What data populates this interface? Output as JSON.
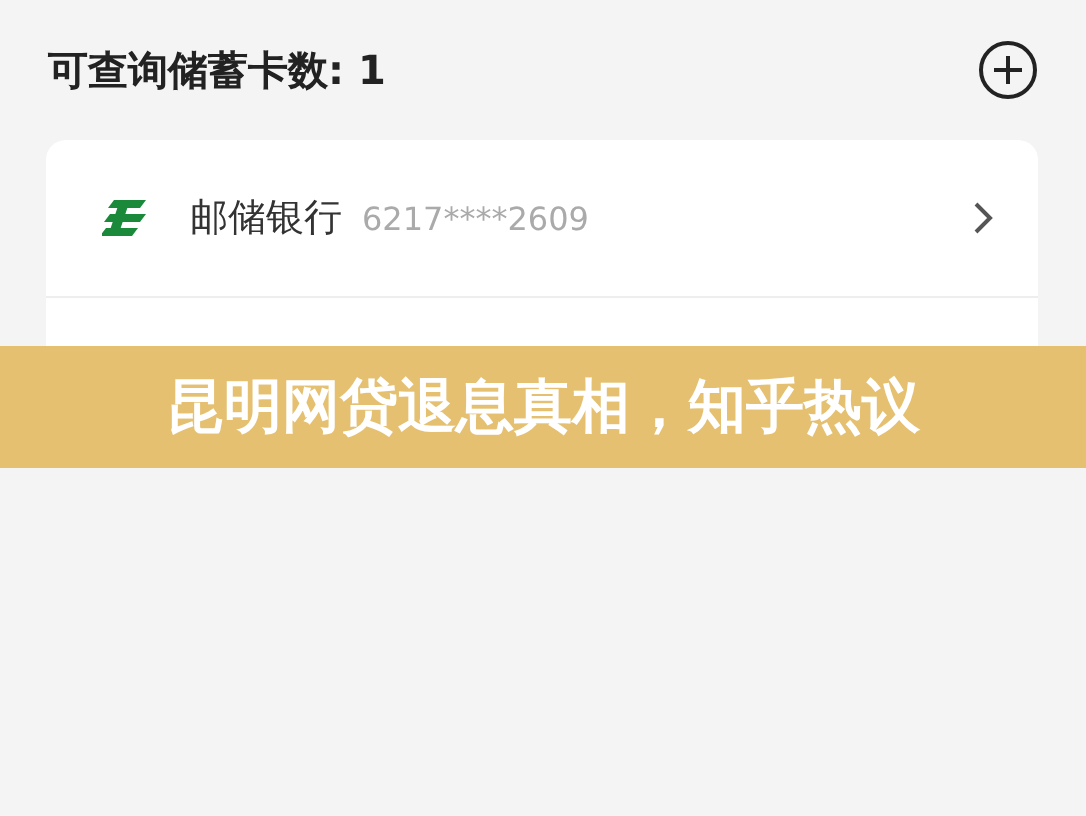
{
  "header": {
    "title": "可查询储蓄卡数: 1"
  },
  "card": {
    "bank": "邮储银行",
    "number": "6217****2609"
  },
  "banner": {
    "text": "昆明网贷退息真相，知乎热议"
  }
}
